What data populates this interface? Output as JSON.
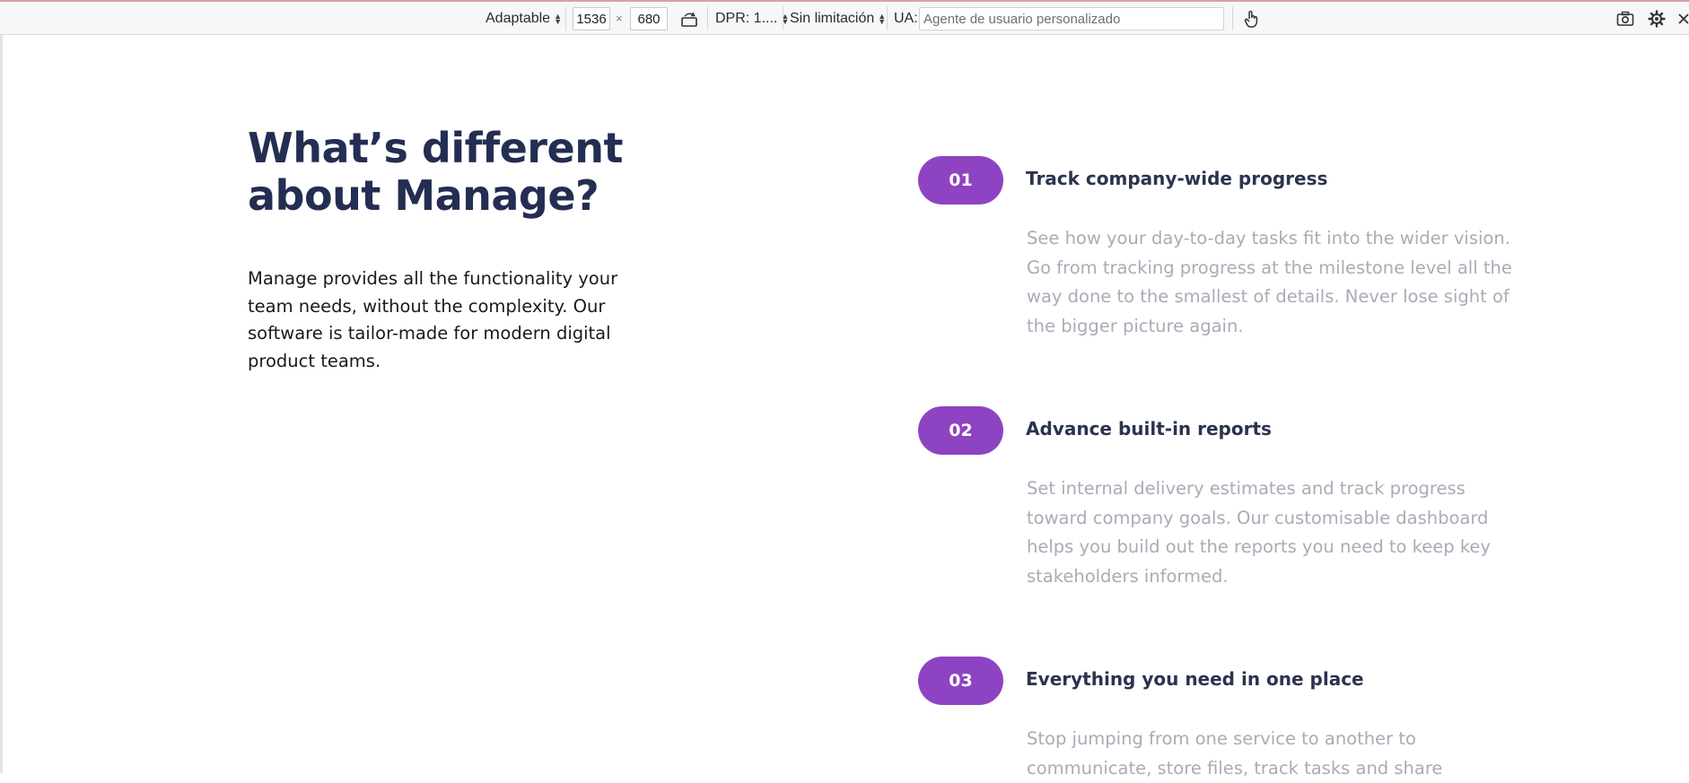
{
  "toolbar": {
    "device_label": "Adaptable",
    "width_value": "1536",
    "times_symbol": "×",
    "height_value": "680",
    "dpr_label": "DPR: 1....",
    "throttle_label": "Sin limitación",
    "ua_label": "UA:",
    "ua_placeholder": "Agente de usuario personalizado",
    "icons": [
      "rotate-icon",
      "touch-icon",
      "screenshot-icon",
      "settings-icon",
      "close-icon"
    ]
  },
  "page": {
    "heading": "What’s different about Manage?",
    "intro": "Manage provides all the functionality your team needs, without the complexity. Our software is tailor-made for modern digital product teams.",
    "accent_color": "#8e44c2",
    "heading_color": "#242d52",
    "features": [
      {
        "number": "01",
        "title": "Track company-wide progress",
        "description": "See how your day-to-day tasks fit into the wider vision. Go from tracking progress at the milestone level all the way done to the smallest of details. Never lose sight of the bigger picture again."
      },
      {
        "number": "02",
        "title": "Advance built-in reports",
        "description": "Set internal delivery estimates and track progress toward company goals. Our customisable dashboard helps you build out the reports you need to keep key stakeholders informed."
      },
      {
        "number": "03",
        "title": "Everything you need in one place",
        "description": "Stop jumping from one service to another to communicate, store files, track tasks and share"
      }
    ]
  }
}
